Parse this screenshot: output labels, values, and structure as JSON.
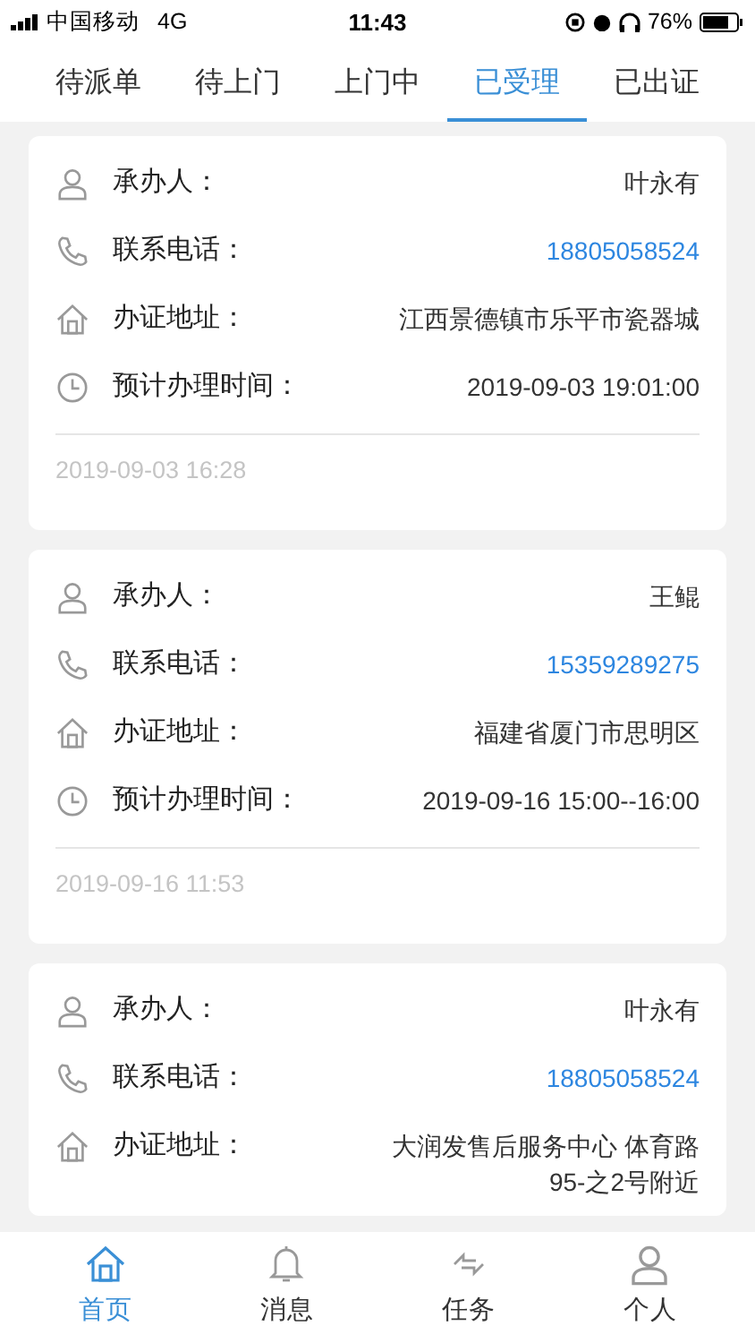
{
  "status_bar": {
    "carrier": "中国移动",
    "network": "4G",
    "time": "11:43",
    "battery": "76%"
  },
  "tabs": [
    {
      "label": "待派单",
      "selected": false
    },
    {
      "label": "待上门",
      "selected": false
    },
    {
      "label": "上门中",
      "selected": false
    },
    {
      "label": "已受理",
      "selected": true
    },
    {
      "label": "已出证",
      "selected": false
    }
  ],
  "cards": [
    {
      "fields": [
        {
          "kind": "person",
          "label": "承办人：",
          "value": "叶永有"
        },
        {
          "kind": "phone",
          "label": "联系电话：",
          "value": "18805058524"
        },
        {
          "kind": "address",
          "label": "办证地址：",
          "value": "江西景德镇市乐平市瓷器城"
        },
        {
          "kind": "time",
          "label": "预计办理时间：",
          "value": "2019-09-03 19:01:00"
        }
      ],
      "created": "2019-09-03 16:28"
    },
    {
      "fields": [
        {
          "kind": "person",
          "label": "承办人：",
          "value": "王鲲"
        },
        {
          "kind": "phone",
          "label": "联系电话：",
          "value": "15359289275"
        },
        {
          "kind": "address",
          "label": "办证地址：",
          "value": "福建省厦门市思明区"
        },
        {
          "kind": "time",
          "label": "预计办理时间：",
          "value": "2019-09-16 15:00--16:00"
        }
      ],
      "created": "2019-09-16 11:53"
    },
    {
      "fields": [
        {
          "kind": "person",
          "label": "承办人：",
          "value": "叶永有"
        },
        {
          "kind": "phone",
          "label": "联系电话：",
          "value": "18805058524"
        },
        {
          "kind": "address",
          "label": "办证地址：",
          "value": "大润发售后服务中心 体育路95-之2号附近"
        }
      ]
    }
  ],
  "bottom_nav": [
    {
      "kind": "home",
      "label": "首页",
      "selected": true
    },
    {
      "kind": "bell",
      "label": "消息",
      "selected": false
    },
    {
      "kind": "swap",
      "label": "任务",
      "selected": false
    },
    {
      "kind": "person",
      "label": "个人",
      "selected": false
    }
  ]
}
